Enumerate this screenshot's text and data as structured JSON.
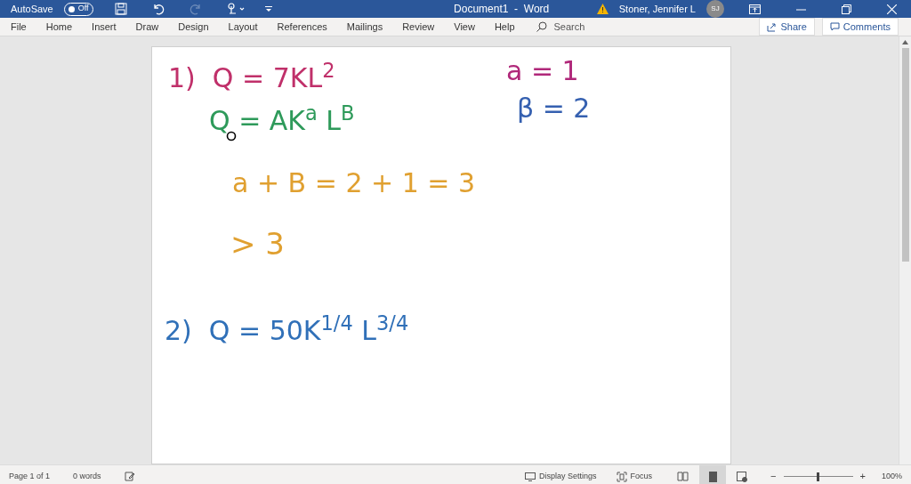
{
  "title_bar": {
    "autosave_label": "AutoSave",
    "autosave_toggle": {
      "label": "Off",
      "on": false
    },
    "document_title": "Document1  -  Word",
    "user_name": "Stoner, Jennifer L",
    "user_initials": "SJ"
  },
  "ribbon_tabs": [
    "File",
    "Home",
    "Insert",
    "Draw",
    "Design",
    "Layout",
    "References",
    "Mailings",
    "Review",
    "View",
    "Help"
  ],
  "search": {
    "placeholder": "Search"
  },
  "share_button": "Share",
  "comments_button": "Comments",
  "ink": [
    {
      "text": "1)  Q = 7KL$^{2}$",
      "color": "#c0306a"
    },
    {
      "text": "Q = AK$^{a}$ L$^{B}$",
      "color": "#2e9a5a"
    },
    {
      "text": "a = 1",
      "color": "#b0287a"
    },
    {
      "text": "β = 2",
      "color": "#3560b0"
    },
    {
      "text": "a + B = 2 + 1 = 3",
      "color": "#e0a030"
    },
    {
      "text": "> 3",
      "color": "#e0a030"
    },
    {
      "text": "2)  Q = 50K$^{1/4}$ L$^{3/4}$",
      "color": "#3070b8"
    }
  ],
  "status_bar": {
    "page": "Page 1 of 1",
    "words": "0 words",
    "display_settings": "Display Settings",
    "focus": "Focus",
    "zoom": {
      "level": 0.5,
      "minus": "−",
      "plus": "+",
      "percent": "100%"
    }
  }
}
